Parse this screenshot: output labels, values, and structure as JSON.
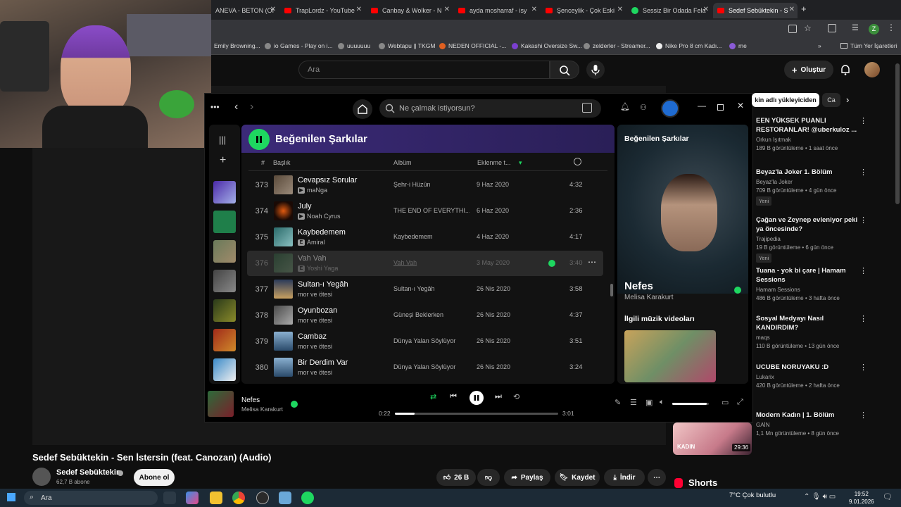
{
  "browser": {
    "tabs": [
      {
        "label": "ANEVA - BETON (Of"
      },
      {
        "label": "TrapLordz - YouTube"
      },
      {
        "label": "Canbay & Wolker - N"
      },
      {
        "label": "ayda mosharraf - isy"
      },
      {
        "label": "Şenceylik - Çok Eski"
      },
      {
        "label": "Sessiz Bir Odada Fela"
      },
      {
        "label": "Sedef Sebüktekin - S"
      }
    ],
    "bookmarks": [
      "Emily Browning...",
      "io Games - Play on i...",
      "uuuuuuu",
      "Webtapu || TKGM",
      "NEDEN OFFICIAL -...",
      "Kakashi Oversize Sw...",
      "zelderler - Streamer...",
      "Nike Pro 8 cm Kadı...",
      "me"
    ],
    "all_bookmarks": "Tüm Yer İşaretleri",
    "profile_letter": "Z"
  },
  "youtube": {
    "search_placeholder": "Ara",
    "create_label": "Oluştur",
    "chip_active": "kin adlı yükleyiciden",
    "chip_next": "Ca",
    "video_title": "Sedef Sebüktekin - Sen İstersin (feat. Canozan) (Audio)",
    "channel_name": "Sedef Sebüktekin",
    "channel_subs": "62,7 B abone",
    "subscribe_label": "Abone ol",
    "like_count": "26 B",
    "share_label": "Paylaş",
    "save_label": "Kaydet",
    "download_label": "İndir",
    "shorts_label": "Shorts",
    "recommendations": [
      {
        "title": "EEN YÜKSEK PUANLI RESTORANLAR! @uberkuloz ...",
        "channel": "Orkun Işıtmak",
        "meta": "189 B görüntüleme • 1 saat önce",
        "new": ""
      },
      {
        "title": "Beyaz'la Joker 1. Bölüm",
        "channel": "Beyaz'la Joker",
        "meta": "709 B görüntüleme • 4 gün önce",
        "new": "Yeni"
      },
      {
        "title": "Çağan ve Zeynep evleniyor peki ya öncesinde?",
        "channel": "Trajipedia",
        "meta": "19 B görüntüleme • 6 gün önce",
        "new": "Yeni"
      },
      {
        "title": "Tuana - yok bi çare | Hamam Sessions",
        "channel": "Hamam Sessions",
        "meta": "486 B görüntüleme • 3 hafta önce",
        "new": ""
      },
      {
        "title": "Sosyal Medyayı Nasıl KANDIRDIM?",
        "channel": "maqs",
        "meta": "110 B görüntüleme • 13 gün önce",
        "new": ""
      },
      {
        "title": "UCUBE NORUYAKU :D",
        "channel": "Lukarix",
        "meta": "420 B görüntüleme • 2 hafta önce",
        "new": ""
      },
      {
        "title": "Modern Kadın | 1. Bölüm",
        "channel": "GAİN",
        "meta": "1,1 Mn görüntüleme • 8 gün önce",
        "new": ""
      }
    ],
    "rec_thumb_duration": "29:36",
    "rec_thumb_text": "KADIN"
  },
  "spotify": {
    "search_placeholder": "Ne çalmak istiyorsun?",
    "playlist_title": "Beğenilen Şarkılar",
    "columns": {
      "num": "#",
      "title": "Başlık",
      "album": "Albüm",
      "added": "Eklenme t..."
    },
    "rows": [
      {
        "num": "373",
        "title": "Cevapsız Sorular",
        "artist": "maNga",
        "badge": "▶",
        "album": "Şehr-i Hüzün",
        "date": "9 Haz 2020",
        "dur": "4:32"
      },
      {
        "num": "374",
        "title": "July",
        "artist": "Noah Cyrus",
        "badge": "▶",
        "album": "THE END OF EVERYTHI...",
        "date": "6 Haz 2020",
        "dur": "2:36"
      },
      {
        "num": "375",
        "title": "Kaybedemem",
        "artist": "Amiral",
        "badge": "E",
        "album": "Kaybedemem",
        "date": "4 Haz 2020",
        "dur": "4:17"
      },
      {
        "num": "376",
        "title": "Vah Vah",
        "artist": "Yoshi Yaga",
        "badge": "E",
        "album": "Vah Vah",
        "date": "3 May 2020",
        "dur": "3:40"
      },
      {
        "num": "377",
        "title": "Sultan-ı Yegâh",
        "artist": "mor ve ötesi",
        "badge": "",
        "album": "Sultan-ı Yegâh",
        "date": "26 Nis 2020",
        "dur": "3:58"
      },
      {
        "num": "378",
        "title": "Oyunbozan",
        "artist": "mor ve ötesi",
        "badge": "",
        "album": "Güneşi Beklerken",
        "date": "26 Nis 2020",
        "dur": "4:37"
      },
      {
        "num": "379",
        "title": "Cambaz",
        "artist": "mor ve ötesi",
        "badge": "",
        "album": "Dünya Yalan Söylüyor",
        "date": "26 Nis 2020",
        "dur": "3:51"
      },
      {
        "num": "380",
        "title": "Bir Derdim Var",
        "artist": "mor ve ötesi",
        "badge": "",
        "album": "Dünya Yalan Söylüyor",
        "date": "26 Nis 2020",
        "dur": "3:24"
      }
    ],
    "now_playing_panel": {
      "label": "Beğenilen Şarkılar",
      "song": "Nefes",
      "artist": "Melisa Karakurt",
      "related": "İlgili müzik videoları"
    },
    "player": {
      "song": "Nefes",
      "artist": "Melisa Karakurt",
      "current_time": "0:22",
      "total_time": "3:01",
      "progress": 0.12,
      "volume": 0.95
    }
  },
  "taskbar": {
    "search_label": "Ara",
    "weather": "7°C  Çok bulutlu",
    "time": "19:52",
    "date": "9.01.2026"
  }
}
